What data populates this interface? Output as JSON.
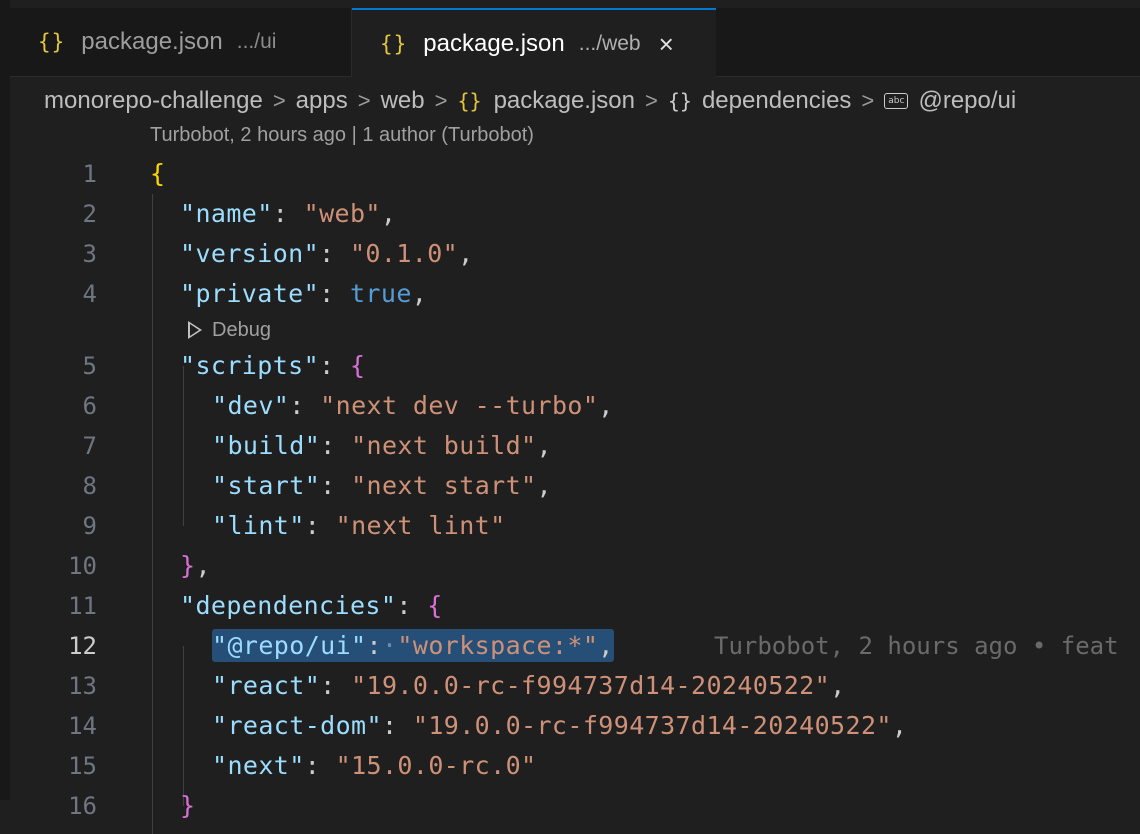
{
  "tabs": [
    {
      "icon": "{}",
      "name": "package.json",
      "description": ".../ui",
      "active": false
    },
    {
      "icon": "{}",
      "name": "package.json",
      "description": ".../web",
      "active": true,
      "close": "×"
    }
  ],
  "breadcrumb": {
    "items": [
      "monorepo-challenge",
      "apps",
      "web",
      "package.json",
      "dependencies",
      "@repo/ui"
    ],
    "separator": ">",
    "json_icon": "{}",
    "object_icon": "{}",
    "string_icon": "abc"
  },
  "codelens_top": "Turbobot, 2 hours ago | 1 author (Turbobot)",
  "debug_lens": "Debug",
  "blame": "Turbobot, 2 hours ago • feat",
  "active_line": 12,
  "line_numbers": [
    "1",
    "2",
    "3",
    "4",
    "5",
    "6",
    "7",
    "8",
    "9",
    "10",
    "11",
    "12",
    "13",
    "14",
    "15",
    "16"
  ],
  "code": {
    "open_brace": "{",
    "name_key": "\"name\"",
    "name_val": "\"web\"",
    "version_key": "\"version\"",
    "version_val": "\"0.1.0\"",
    "private_key": "\"private\"",
    "private_val": "true",
    "scripts_key": "\"scripts\"",
    "dev_key": "\"dev\"",
    "dev_val": "\"next dev --turbo\"",
    "build_key": "\"build\"",
    "build_val": "\"next build\"",
    "start_key": "\"start\"",
    "start_val": "\"next start\"",
    "lint_key": "\"lint\"",
    "lint_val": "\"next lint\"",
    "close_scripts": "}",
    "dependencies_key": "\"dependencies\"",
    "repo_ui_key": "\"@repo/ui\"",
    "repo_ui_val": "\"workspace:*\"",
    "react_key": "\"react\"",
    "react_val": "\"19.0.0-rc-f994737d14-20240522\"",
    "react_dom_key": "\"react-dom\"",
    "react_dom_val": "\"19.0.0-rc-f994737d14-20240522\"",
    "next_key": "\"next\"",
    "next_val": "\"15.0.0-rc.0\"",
    "close_deps": "}"
  }
}
